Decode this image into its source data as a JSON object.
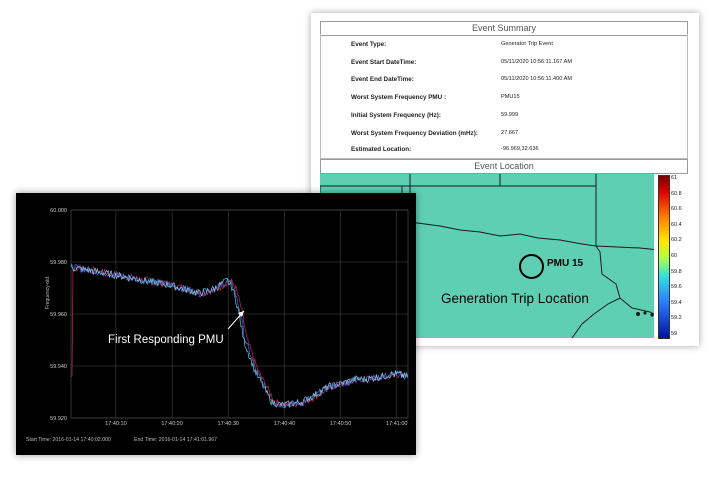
{
  "summary": {
    "title": "Event Summary",
    "rows": [
      {
        "label": "Event Type:",
        "value": "Generator Trip Event"
      },
      {
        "label": "Event Start DateTime:",
        "value": "05/11/2020 10:56:11.167 AM"
      },
      {
        "label": "Event End DateTime:",
        "value": "05/11/2020 10:56:11.400 AM"
      },
      {
        "label": "Worst System Frequency PMU :",
        "value": "PMU15"
      },
      {
        "label": "Initial System Frequency (Hz):",
        "value": "59.999"
      },
      {
        "label": "Worst System Frequency Deviation (mHz):",
        "value": "27.667"
      },
      {
        "label": "Estimated Location:",
        "value": "-96.969,32.636"
      }
    ]
  },
  "location": {
    "title": "Event Location",
    "pmu_label": "PMU 15",
    "trip_label": "Generation Trip Location",
    "colorbar_ticks": [
      "61",
      "60.8",
      "60.6",
      "60.4",
      "60.2",
      "60",
      "59.8",
      "59.6",
      "59.4",
      "59.2",
      "59"
    ],
    "colors": {
      "map_fill": "#5ecfb3",
      "border": "#1a1a1a"
    }
  },
  "freq_chart": {
    "ylabel": "Frequency-old",
    "annotation": "First Responding PMU",
    "start_time": "Start Time: 2016-01-14 17:40:02.000",
    "end_time": "End Time: 2016-01-14 17:41:01.967",
    "colors": {
      "background": "#000000",
      "trace_blue": "#4a7dff",
      "trace_red": "#d8285a",
      "trace_cyan": "#7ed8f0"
    }
  },
  "chart_data": {
    "type": "line",
    "title": "",
    "xlabel": "",
    "ylabel": "Frequency-old",
    "y_ticks": [
      "60.000",
      "59.980",
      "59.960",
      "59.940",
      "59.920"
    ],
    "x_ticks": [
      "17:40:10",
      "17:40:20",
      "17:40:30",
      "17:40:40",
      "17:40:50",
      "17:41:00"
    ],
    "ylim": [
      59.92,
      60.0
    ],
    "xlim": [
      "17:40:02",
      "17:41:02"
    ],
    "grid": true,
    "series": [
      {
        "x": [
          "17:40:02",
          "17:40:05",
          "17:40:10",
          "17:40:15",
          "17:40:20",
          "17:40:25",
          "17:40:28",
          "17:40:30",
          "17:40:31",
          "17:40:32",
          "17:40:33",
          "17:40:35",
          "17:40:37",
          "17:40:38",
          "17:40:40",
          "17:40:43",
          "17:40:45",
          "17:40:48",
          "17:40:50",
          "17:40:53",
          "17:40:55",
          "17:41:00",
          "17:41:02"
        ],
        "values": [
          59.978,
          59.977,
          59.975,
          59.973,
          59.971,
          59.968,
          59.97,
          59.973,
          59.97,
          59.962,
          59.95,
          59.938,
          59.93,
          59.926,
          59.925,
          59.926,
          59.928,
          59.932,
          59.933,
          59.935,
          59.935,
          59.937,
          59.936
        ]
      }
    ]
  }
}
